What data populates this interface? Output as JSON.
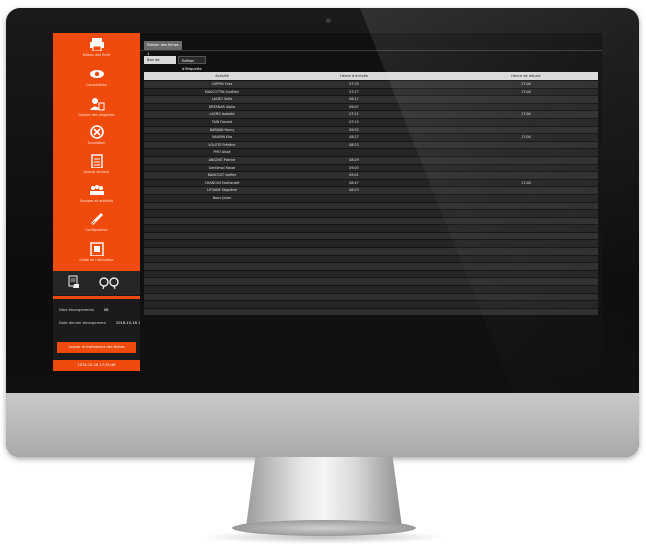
{
  "sidebar": {
    "items": [
      {
        "icon": "printer-icon",
        "label": "Edition des fiche"
      },
      {
        "icon": "eye-icon",
        "label": "Consultation"
      },
      {
        "icon": "person-badge-icon",
        "label": "Gestion des stagiaires"
      },
      {
        "icon": "cross-circle-icon",
        "label": "Annulation"
      },
      {
        "icon": "calendar-icon",
        "label": "Journal de bord"
      },
      {
        "icon": "group-icon",
        "label": "Groupes et activités"
      },
      {
        "icon": "wrench-icon",
        "label": "Configuration"
      },
      {
        "icon": "book-icon",
        "label": "Guide de l'utilisateur"
      }
    ],
    "stats": [
      {
        "label": "Nbre émargements",
        "value": "08"
      },
      {
        "label": "Date dernier émargement",
        "value": "2016-10-18 17:35:48"
      }
    ],
    "action_label": "Lancer le traitement des fiches",
    "footer": "2016-10-18 17:35:48"
  },
  "main": {
    "tab_label": "Edition des fiches - 1",
    "buttons": [
      "Bon de paiement",
      "Edition d'étiquette"
    ],
    "columns": [
      "Activité",
      "Heure d'arrivée",
      "Heure de départ"
    ],
    "rows": [
      [
        "CAPPIN Yves",
        "07:35",
        "17:00"
      ],
      [
        "MASCOTTIN Aurélien",
        "07:17",
        "17:00"
      ],
      [
        "LACRO Sofia",
        "08:17",
        ""
      ],
      [
        "DRESNAR Alpha",
        "09:07",
        ""
      ],
      [
        "LACRO Isabelle",
        "07:21",
        "17:00"
      ],
      [
        "TAIN Donald",
        "07:15",
        ""
      ],
      [
        "BARBAN Fanny",
        "09:52",
        ""
      ],
      [
        "NAURIN Elia",
        "08:27",
        "17:00"
      ],
      [
        "VOLOTE Frédéric",
        "08:23",
        ""
      ],
      [
        "PIYO Aïssé",
        "",
        ""
      ],
      [
        "ANGONT Patrice",
        "08:29",
        ""
      ],
      [
        "Gentilmoi Rasse",
        "09:05",
        ""
      ],
      [
        "BANCOUT Valérie",
        "09:01",
        ""
      ],
      [
        "CHANOUX Nathanaël",
        "08:47",
        "17:00"
      ],
      [
        "LITVANE Ségolène",
        "08:23",
        ""
      ],
      [
        "Noux Julian",
        "",
        ""
      ]
    ],
    "empty_rows": 15
  }
}
